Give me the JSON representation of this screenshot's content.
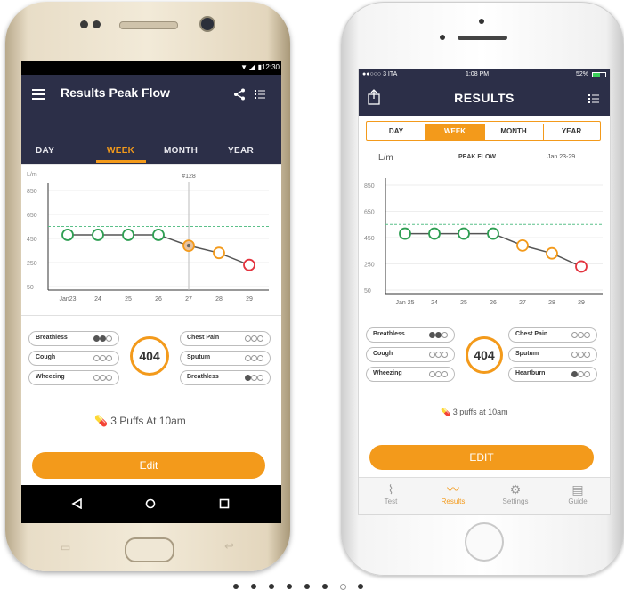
{
  "android": {
    "status_time": "12:30",
    "app_title": "Results Peak Flow",
    "tabs": [
      "DAY",
      "WEEK",
      "MONTH",
      "YEAR"
    ],
    "active_tab": "WEEK",
    "chart_unit": "L/m",
    "marker_label": "#128",
    "score": "404",
    "symptoms_left": [
      {
        "label": "Breathless",
        "level": 2
      },
      {
        "label": "Cough",
        "level": 0
      },
      {
        "label": "Wheezing",
        "level": 0
      }
    ],
    "symptoms_right": [
      {
        "label": "Chest Pain",
        "level": 0
      },
      {
        "label": "Sputum",
        "level": 0
      },
      {
        "label": "Breathless",
        "level": 1
      }
    ],
    "medication": "3 Puffs At 10am",
    "edit_label": "Edit"
  },
  "iphone": {
    "status_carrier": "●●○○○ 3 ITA",
    "status_time": "1:08 PM",
    "status_battery": "52%",
    "app_title": "RESULTS",
    "segments": [
      "DAY",
      "WEEK",
      "MONTH",
      "YEAR"
    ],
    "active_segment": "WEEK",
    "chart_unit": "L/m",
    "chart_title": "PEAK FLOW",
    "chart_range": "Jan 23-29",
    "score": "404",
    "symptoms_left": [
      {
        "label": "Breathless",
        "level": 2
      },
      {
        "label": "Cough",
        "level": 0
      },
      {
        "label": "Wheezing",
        "level": 0
      }
    ],
    "symptoms_right": [
      {
        "label": "Chest Pain",
        "level": 0
      },
      {
        "label": "Sputum",
        "level": 0
      },
      {
        "label": "Heartburn",
        "level": 1
      }
    ],
    "medication": "3 puffs at 10am",
    "edit_label": "EDIT",
    "tab_bar": [
      {
        "label": "Test",
        "icon": "spirometer-icon"
      },
      {
        "label": "Results",
        "icon": "trend-chart-icon"
      },
      {
        "label": "Settings",
        "icon": "gear-icon"
      },
      {
        "label": "Guide",
        "icon": "book-icon"
      }
    ],
    "active_tab_bar": "Results"
  },
  "colors": {
    "accent": "#f39a1b",
    "header": "#2c2f48",
    "good": "#2e9e52",
    "warn": "#f39a1b",
    "bad": "#e3343f",
    "target_line": "#5cc08a"
  },
  "chart_data": [
    {
      "type": "line",
      "x": [
        "Jan23",
        "24",
        "25",
        "26",
        "27",
        "28",
        "29"
      ],
      "y": [
        480,
        480,
        480,
        480,
        390,
        330,
        230
      ],
      "status": [
        "good",
        "good",
        "good",
        "good",
        "warn",
        "warn",
        "bad"
      ],
      "yticks": [
        50,
        250,
        450,
        650,
        850
      ],
      "ylim": [
        50,
        850
      ],
      "target": 550,
      "ylabel": "L/m",
      "highlight_index": 4
    },
    {
      "type": "line",
      "title": "PEAK FLOW",
      "x": [
        "Jan 25",
        "24",
        "25",
        "26",
        "27",
        "28",
        "29"
      ],
      "y": [
        480,
        480,
        480,
        480,
        390,
        330,
        230
      ],
      "status": [
        "good",
        "good",
        "good",
        "good",
        "warn",
        "warn",
        "bad"
      ],
      "yticks": [
        50,
        250,
        450,
        650,
        850
      ],
      "ylim": [
        50,
        850
      ],
      "target": 550,
      "ylabel": "L/m"
    }
  ],
  "pager": {
    "count": 8,
    "active_index": 6
  }
}
